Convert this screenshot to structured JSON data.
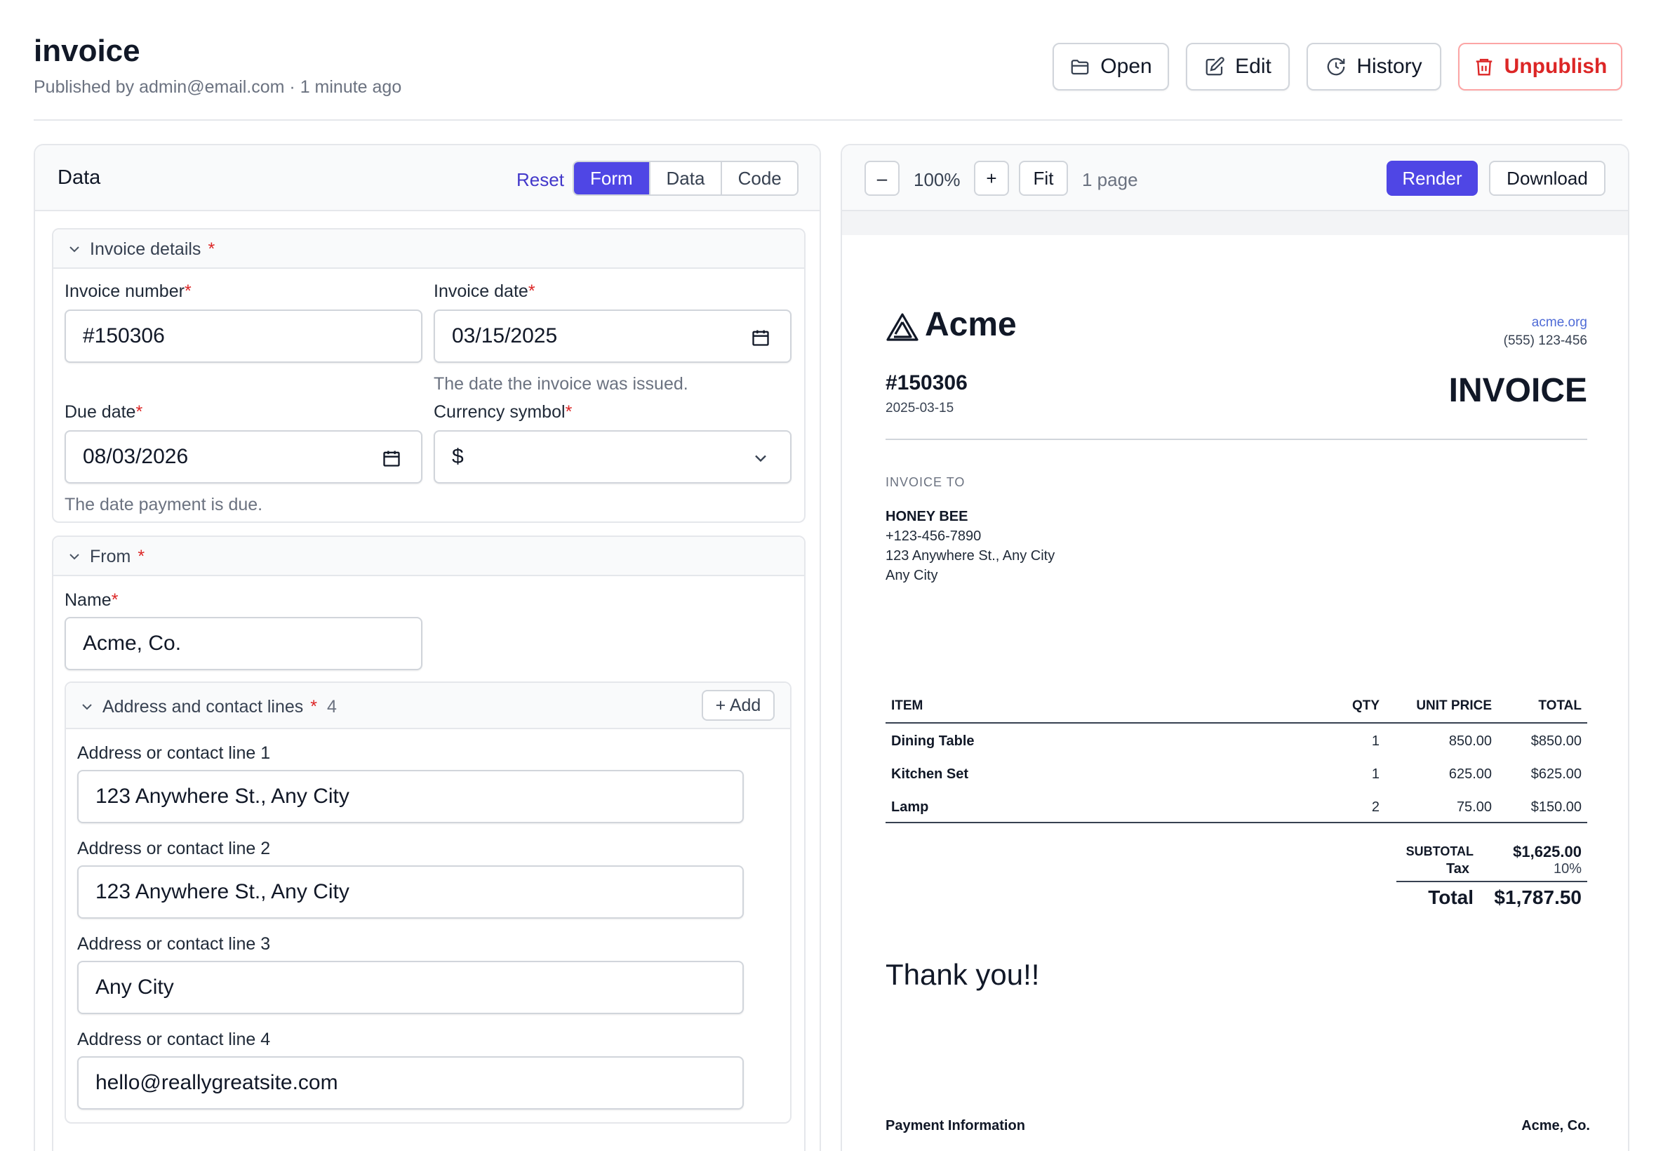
{
  "header": {
    "title": "invoice",
    "subtitle": "Published by admin@email.com · 1 minute ago",
    "buttons": {
      "open": "Open",
      "edit": "Edit",
      "history": "History",
      "unpublish": "Unpublish"
    }
  },
  "left_panel": {
    "title": "Data",
    "reset": "Reset",
    "tabs": [
      "Form",
      "Data",
      "Code"
    ],
    "active_tab": "Form",
    "sections": {
      "invoice_details": {
        "title": "Invoice details",
        "fields": {
          "invoice_number": {
            "label": "Invoice number",
            "value": "#150306"
          },
          "invoice_date": {
            "label": "Invoice date",
            "value": "03/15/2025",
            "hint": "The date the invoice was issued."
          },
          "due_date": {
            "label": "Due date",
            "value": "08/03/2026",
            "hint": "The date payment is due."
          },
          "currency_symbol": {
            "label": "Currency symbol",
            "value": "$"
          }
        }
      },
      "from": {
        "title": "From",
        "name": {
          "label": "Name",
          "value": "Acme, Co."
        },
        "address": {
          "title": "Address and contact lines",
          "count": "4",
          "add_label": "+ Add",
          "lines": [
            {
              "label": "Address or contact line 1",
              "value": "123 Anywhere St., Any City"
            },
            {
              "label": "Address or contact line 2",
              "value": "123 Anywhere St., Any City"
            },
            {
              "label": "Address or contact line 3",
              "value": "Any City"
            },
            {
              "label": "Address or contact line 4",
              "value": "hello@reallygreatsite.com"
            }
          ]
        }
      }
    }
  },
  "preview": {
    "toolbar": {
      "zoom_out": "–",
      "zoom": "100%",
      "zoom_in": "+",
      "fit": "Fit",
      "pages": "1 page",
      "render": "Render",
      "download": "Download"
    },
    "document": {
      "brand": "Acme",
      "website": "acme.org",
      "phone": "(555) 123-456",
      "invoice_number": "#150306",
      "invoice_date": "2025-03-15",
      "doc_title": "INVOICE",
      "invoice_to_label": "INVOICE TO",
      "bill_to": {
        "name": "HONEY BEE",
        "lines": [
          "+123-456-7890",
          "123 Anywhere St., Any City",
          "Any City"
        ]
      },
      "table": {
        "headers": [
          "ITEM",
          "QTY",
          "UNIT PRICE",
          "TOTAL"
        ],
        "rows": [
          [
            "Dining Table",
            "1",
            "850.00",
            "$850.00"
          ],
          [
            "Kitchen Set",
            "1",
            "625.00",
            "$625.00"
          ],
          [
            "Lamp",
            "2",
            "75.00",
            "$150.00"
          ]
        ]
      },
      "subtotal_label": "SUBTOTAL",
      "subtotal": "$1,625.00",
      "tax_label": "Tax",
      "tax": "10%",
      "total_label": "Total",
      "total": "$1,787.50",
      "thanks": "Thank you!!",
      "payment_label": "Payment Information",
      "company": "Acme, Co."
    }
  },
  "colors": {
    "accent": "#4f46e5",
    "danger": "#dc2626",
    "link": "#4338ca"
  }
}
